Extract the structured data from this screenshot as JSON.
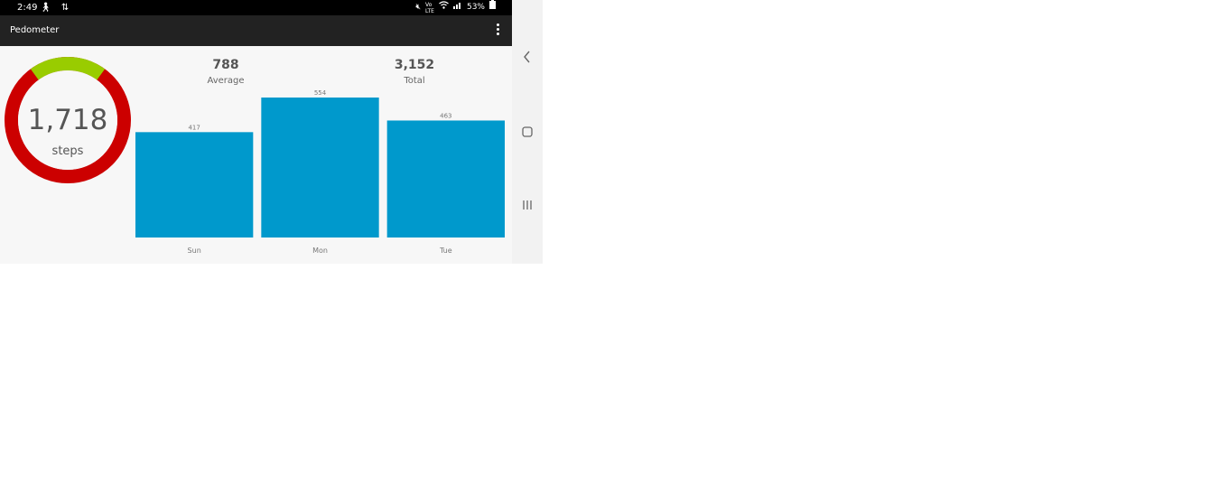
{
  "status_bar": {
    "time": "2:49",
    "left_icons": [
      "person-icon",
      "signal-updown-icon"
    ],
    "battery": "53%",
    "right_icons": [
      "mute-icon",
      "volte-icon",
      "wifi-icon",
      "signal-icon",
      "battery-icon"
    ]
  },
  "app_bar": {
    "title": "Pedometer",
    "menu_icon": "overflow-menu-icon"
  },
  "today": {
    "steps": "1,718",
    "unit": "steps",
    "goal_progress": 0.2,
    "colors": {
      "progress": "#99cc00",
      "remaining": "#cc0000"
    }
  },
  "stats": {
    "average_value": "788",
    "average_label": "Average",
    "total_value": "3,152",
    "total_label": "Total"
  },
  "chart_data": {
    "type": "bar",
    "categories": [
      "Sun",
      "Mon",
      "Tue"
    ],
    "values": [
      417,
      554,
      463
    ],
    "value_labels": [
      "417",
      "554",
      "463"
    ],
    "ylim": [
      0,
      554
    ],
    "grid": false,
    "color": "#0099cc"
  },
  "nav_bar": {
    "back_icon": "back-chevron-icon",
    "home_icon": "home-square-icon",
    "recents_icon": "recents-lines-icon"
  }
}
